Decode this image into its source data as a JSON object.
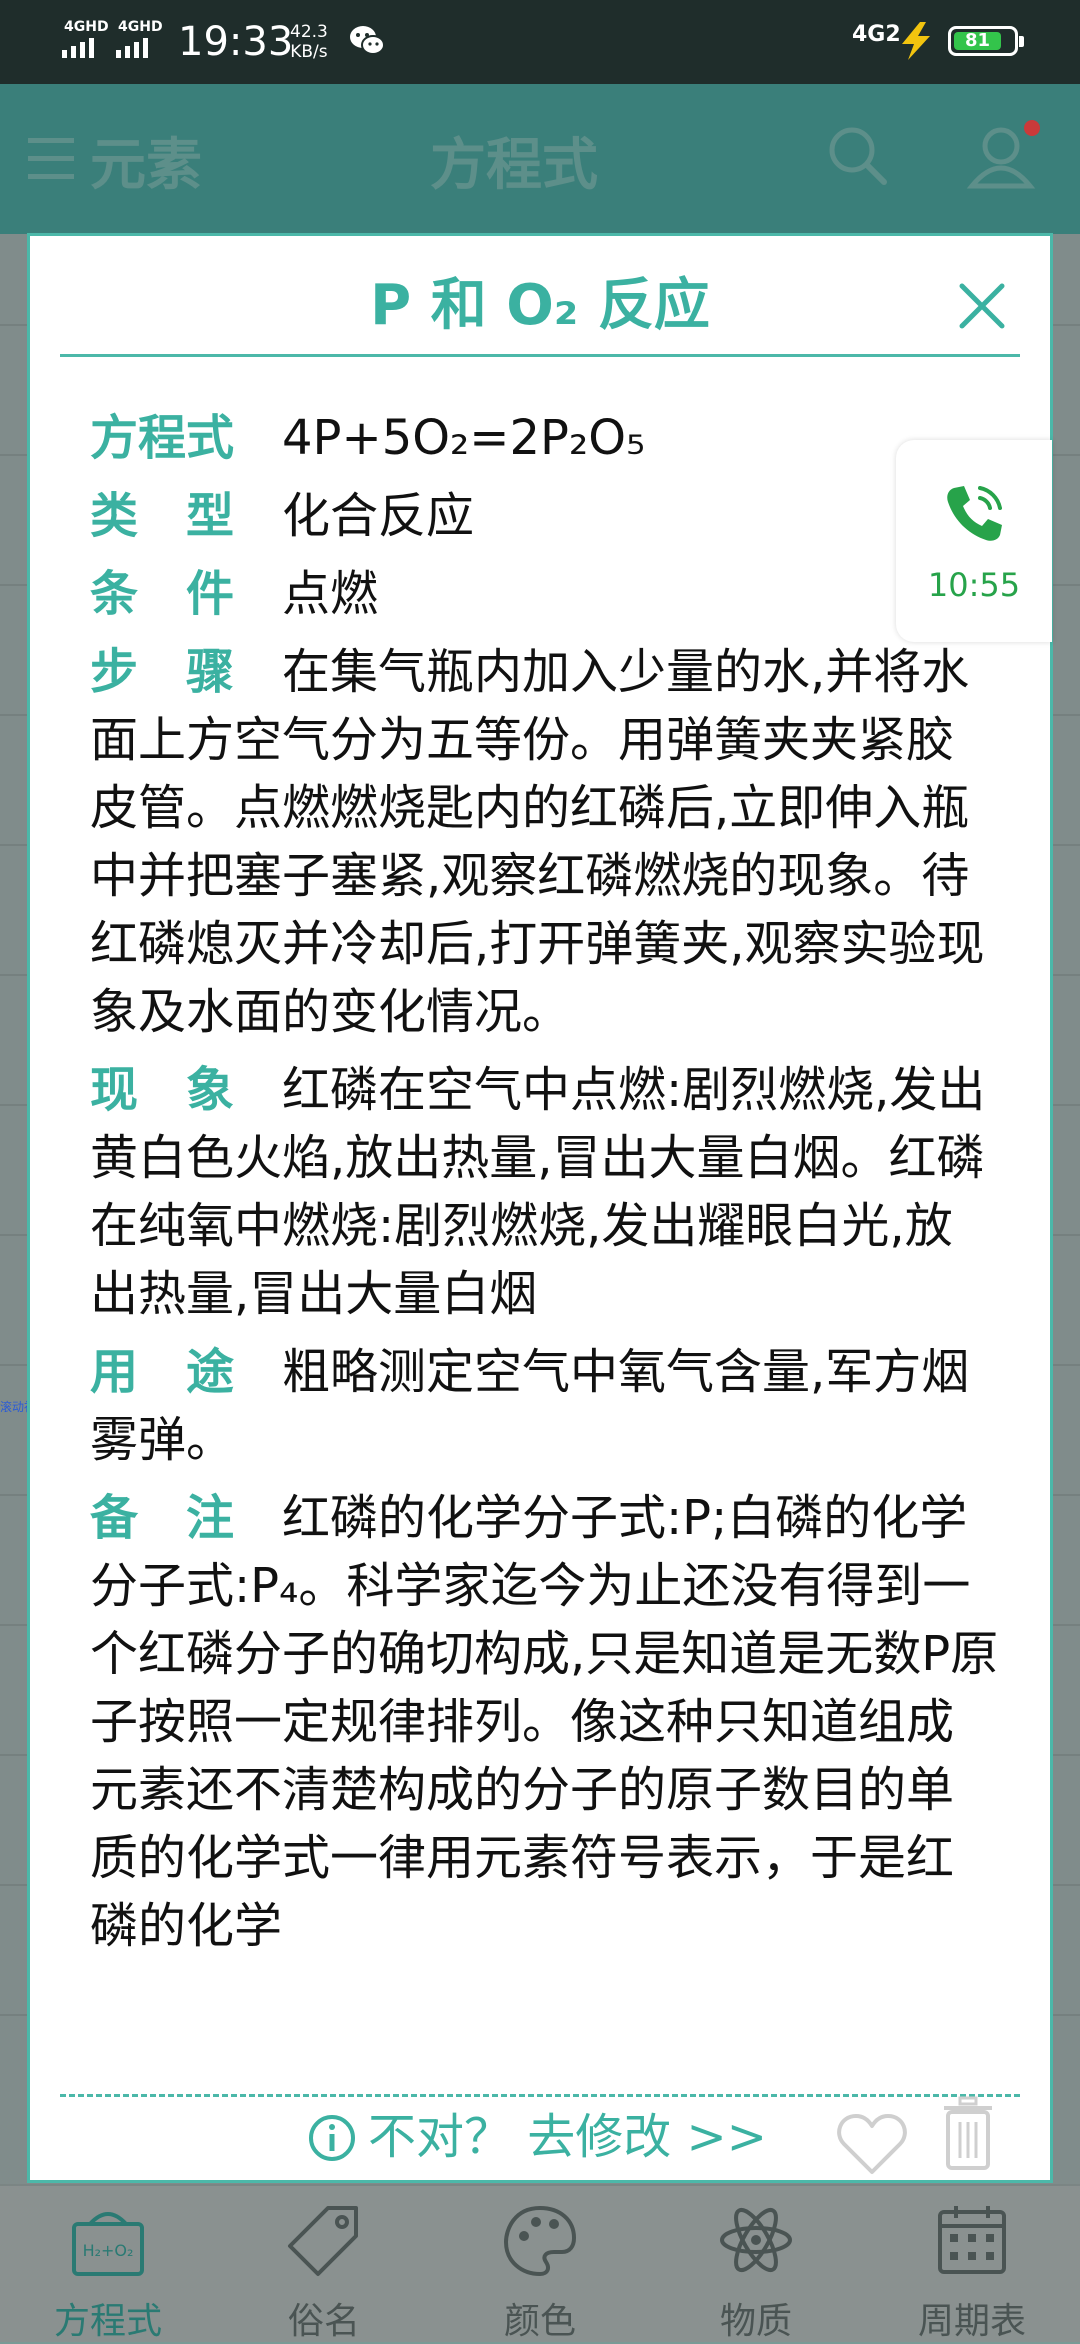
{
  "status_bar": {
    "signal1": "4GHD",
    "signal2": "4GHD",
    "time": "19:33",
    "rate_value": "42.3",
    "rate_unit": "KB/s",
    "network2": "4G2",
    "battery": "81",
    "battery_level": 81
  },
  "app_bar": {
    "left_label": "元素",
    "title": "方程式"
  },
  "dialog": {
    "title": "P 和 O₂ 反应",
    "entries": [
      {
        "label": "方程式",
        "value": "4P+5O₂=2P₂O₅"
      },
      {
        "label": "类　型",
        "value": "化合反应"
      },
      {
        "label": "条　件",
        "value": "点燃"
      },
      {
        "label": "步　骤",
        "value": "在集气瓶内加入少量的水,并将水面上方空气分为五等份。用弹簧夹夹紧胶皮管。点燃燃烧匙内的红磷后,立即伸入瓶中并把塞子塞紧,观察红磷燃烧的现象。待红磷熄灭并冷却后,打开弹簧夹,观察实验现象及水面的变化情况。"
      },
      {
        "label": "现　象",
        "value": "红磷在空气中点燃:剧烈燃烧,发出黄白色火焰,放出热量,冒出大量白烟。红磷在纯氧中燃烧:剧烈燃烧,发出耀眼白光,放出热量,冒出大量白烟"
      },
      {
        "label": "用　途",
        "value": "粗略测定空气中氧气含量,军方烟雾弹。"
      },
      {
        "label": "备　注",
        "value": "红磷的化学分子式:P;白磷的化学分子式:P₄。科学家迄今为止还没有得到一个红磷分子的确切构成,只是知道是无数P原子按照一定规律排列。像这种只知道组成元素还不清楚构成的分子的原子数目的单质的化学式一律用元素符号表示，于是红磷的化学"
      }
    ],
    "report_link": "不对？ 去修改 >>"
  },
  "call_bubble": {
    "time": "10:55"
  },
  "bottom_nav": {
    "items": [
      {
        "label": "方程式"
      },
      {
        "label": "俗名"
      },
      {
        "label": "颜色"
      },
      {
        "label": "物质"
      },
      {
        "label": "周期表"
      }
    ]
  },
  "background": {
    "side_label": "滚动社区"
  },
  "colors": {
    "accent": "#3bb1a1",
    "appbar": "#3a7f7a",
    "call_green": "#27a34a",
    "battery_green": "#33c44b"
  }
}
